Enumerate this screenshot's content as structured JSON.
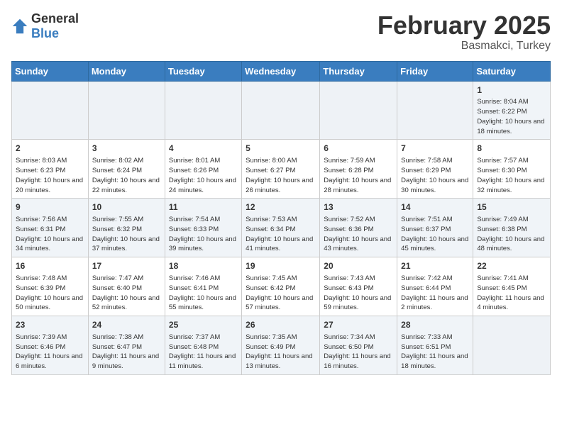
{
  "logo": {
    "text_general": "General",
    "text_blue": "Blue"
  },
  "header": {
    "month": "February 2025",
    "location": "Basmakci, Turkey"
  },
  "days_of_week": [
    "Sunday",
    "Monday",
    "Tuesday",
    "Wednesday",
    "Thursday",
    "Friday",
    "Saturday"
  ],
  "weeks": [
    [
      {
        "day": "",
        "info": ""
      },
      {
        "day": "",
        "info": ""
      },
      {
        "day": "",
        "info": ""
      },
      {
        "day": "",
        "info": ""
      },
      {
        "day": "",
        "info": ""
      },
      {
        "day": "",
        "info": ""
      },
      {
        "day": "1",
        "info": "Sunrise: 8:04 AM\nSunset: 6:22 PM\nDaylight: 10 hours and 18 minutes."
      }
    ],
    [
      {
        "day": "2",
        "info": "Sunrise: 8:03 AM\nSunset: 6:23 PM\nDaylight: 10 hours and 20 minutes."
      },
      {
        "day": "3",
        "info": "Sunrise: 8:02 AM\nSunset: 6:24 PM\nDaylight: 10 hours and 22 minutes."
      },
      {
        "day": "4",
        "info": "Sunrise: 8:01 AM\nSunset: 6:26 PM\nDaylight: 10 hours and 24 minutes."
      },
      {
        "day": "5",
        "info": "Sunrise: 8:00 AM\nSunset: 6:27 PM\nDaylight: 10 hours and 26 minutes."
      },
      {
        "day": "6",
        "info": "Sunrise: 7:59 AM\nSunset: 6:28 PM\nDaylight: 10 hours and 28 minutes."
      },
      {
        "day": "7",
        "info": "Sunrise: 7:58 AM\nSunset: 6:29 PM\nDaylight: 10 hours and 30 minutes."
      },
      {
        "day": "8",
        "info": "Sunrise: 7:57 AM\nSunset: 6:30 PM\nDaylight: 10 hours and 32 minutes."
      }
    ],
    [
      {
        "day": "9",
        "info": "Sunrise: 7:56 AM\nSunset: 6:31 PM\nDaylight: 10 hours and 34 minutes."
      },
      {
        "day": "10",
        "info": "Sunrise: 7:55 AM\nSunset: 6:32 PM\nDaylight: 10 hours and 37 minutes."
      },
      {
        "day": "11",
        "info": "Sunrise: 7:54 AM\nSunset: 6:33 PM\nDaylight: 10 hours and 39 minutes."
      },
      {
        "day": "12",
        "info": "Sunrise: 7:53 AM\nSunset: 6:34 PM\nDaylight: 10 hours and 41 minutes."
      },
      {
        "day": "13",
        "info": "Sunrise: 7:52 AM\nSunset: 6:36 PM\nDaylight: 10 hours and 43 minutes."
      },
      {
        "day": "14",
        "info": "Sunrise: 7:51 AM\nSunset: 6:37 PM\nDaylight: 10 hours and 45 minutes."
      },
      {
        "day": "15",
        "info": "Sunrise: 7:49 AM\nSunset: 6:38 PM\nDaylight: 10 hours and 48 minutes."
      }
    ],
    [
      {
        "day": "16",
        "info": "Sunrise: 7:48 AM\nSunset: 6:39 PM\nDaylight: 10 hours and 50 minutes."
      },
      {
        "day": "17",
        "info": "Sunrise: 7:47 AM\nSunset: 6:40 PM\nDaylight: 10 hours and 52 minutes."
      },
      {
        "day": "18",
        "info": "Sunrise: 7:46 AM\nSunset: 6:41 PM\nDaylight: 10 hours and 55 minutes."
      },
      {
        "day": "19",
        "info": "Sunrise: 7:45 AM\nSunset: 6:42 PM\nDaylight: 10 hours and 57 minutes."
      },
      {
        "day": "20",
        "info": "Sunrise: 7:43 AM\nSunset: 6:43 PM\nDaylight: 10 hours and 59 minutes."
      },
      {
        "day": "21",
        "info": "Sunrise: 7:42 AM\nSunset: 6:44 PM\nDaylight: 11 hours and 2 minutes."
      },
      {
        "day": "22",
        "info": "Sunrise: 7:41 AM\nSunset: 6:45 PM\nDaylight: 11 hours and 4 minutes."
      }
    ],
    [
      {
        "day": "23",
        "info": "Sunrise: 7:39 AM\nSunset: 6:46 PM\nDaylight: 11 hours and 6 minutes."
      },
      {
        "day": "24",
        "info": "Sunrise: 7:38 AM\nSunset: 6:47 PM\nDaylight: 11 hours and 9 minutes."
      },
      {
        "day": "25",
        "info": "Sunrise: 7:37 AM\nSunset: 6:48 PM\nDaylight: 11 hours and 11 minutes."
      },
      {
        "day": "26",
        "info": "Sunrise: 7:35 AM\nSunset: 6:49 PM\nDaylight: 11 hours and 13 minutes."
      },
      {
        "day": "27",
        "info": "Sunrise: 7:34 AM\nSunset: 6:50 PM\nDaylight: 11 hours and 16 minutes."
      },
      {
        "day": "28",
        "info": "Sunrise: 7:33 AM\nSunset: 6:51 PM\nDaylight: 11 hours and 18 minutes."
      },
      {
        "day": "",
        "info": ""
      }
    ]
  ]
}
